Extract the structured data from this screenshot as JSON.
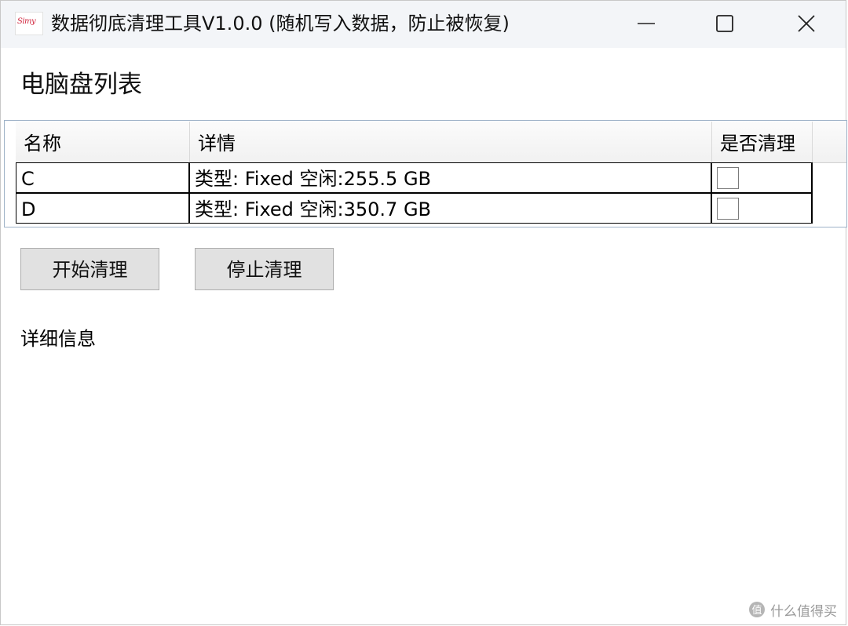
{
  "window": {
    "title": "数据彻底清理工具V1.0.0 (随机写入数据，防止被恢复)",
    "icon_text": "Simy",
    "controls": [
      "minimize-icon",
      "maximize-icon",
      "close-icon"
    ]
  },
  "main": {
    "section_title": "电脑盘列表",
    "grid": {
      "columns": [
        "名称",
        "详情",
        "是否清理"
      ],
      "rows": [
        {
          "name": "C",
          "detail": "类型: Fixed 空闲:255.5 GB",
          "clean": false
        },
        {
          "name": "D",
          "detail": "类型: Fixed 空闲:350.7 GB",
          "clean": false
        }
      ]
    },
    "buttons": {
      "start": "开始清理",
      "stop": "停止清理"
    },
    "detail_label": "详细信息"
  },
  "watermark": {
    "text": "什么值得买",
    "icon": "smzdm-logo-icon"
  },
  "colors": {
    "titlebar": "#f3f5f8",
    "grid_border": "#9fb3c8",
    "button_bg": "#e1e1e1",
    "icon_text": "#d0243c"
  }
}
